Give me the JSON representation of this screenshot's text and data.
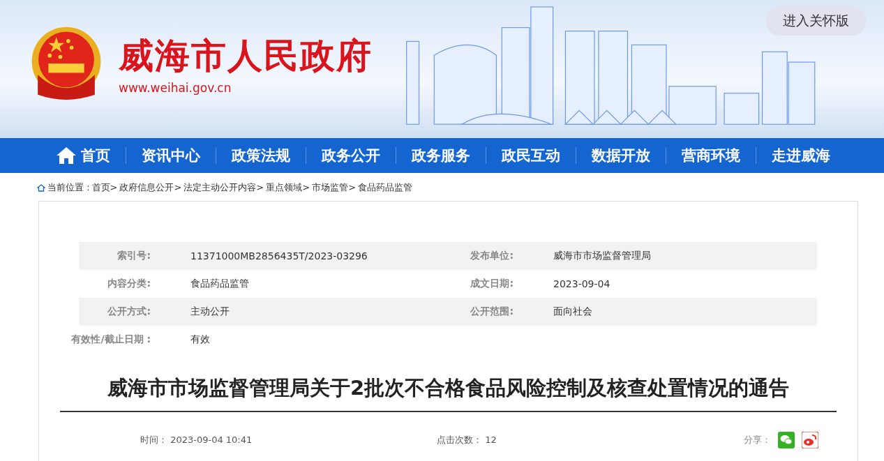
{
  "header": {
    "site_name": "威海市人民政府",
    "url": "www.weihai.gov.cn",
    "care_button": "进入关怀版"
  },
  "nav": [
    {
      "label": "首页",
      "kind": "home"
    },
    {
      "label": "资讯中心",
      "kind": "link"
    },
    {
      "label": "政策法规",
      "kind": "link"
    },
    {
      "label": "政务公开",
      "kind": "link"
    },
    {
      "label": "政务服务",
      "kind": "link"
    },
    {
      "label": "政民互动",
      "kind": "link"
    },
    {
      "label": "数据开放",
      "kind": "link"
    },
    {
      "label": "营商环境",
      "kind": "link"
    },
    {
      "label": "走进威海",
      "kind": "link"
    }
  ],
  "breadcrumb": {
    "label": "当前位置 :",
    "items": [
      "首页>",
      "政府信息公开>",
      "法定主动公开内容>",
      "重点领域>",
      "市场监管>",
      "食品药品监管"
    ]
  },
  "meta": [
    {
      "cells": [
        {
          "label": "索引号:",
          "value": "11371000MB2856435T/2023-03296"
        },
        {
          "label": "发布单位:",
          "value": "威海市市场监督管理局"
        }
      ]
    },
    {
      "cells": [
        {
          "label": "内容分类:",
          "value": "食品药品监管"
        },
        {
          "label": "成文日期:",
          "value": "2023-09-04"
        }
      ]
    },
    {
      "cells": [
        {
          "label": "公开方式:",
          "value": "主动公开"
        },
        {
          "label": "公开范围:",
          "value": "面向社会"
        }
      ]
    },
    {
      "cells": [
        {
          "label": "有效性/截止日期 :",
          "value": "有效"
        }
      ]
    }
  ],
  "article": {
    "title": "威海市市场监督管理局关于2批次不合格食品风险控制及核查处置情况的通告",
    "time_label": "时间：",
    "time": "2023-09-04 10:41",
    "views_label": "点击次数：",
    "views": "12",
    "share_label": "分享："
  }
}
